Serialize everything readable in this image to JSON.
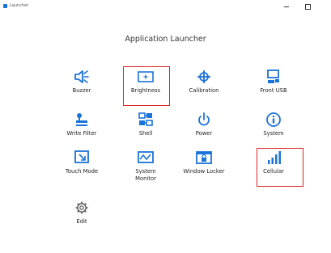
{
  "window": {
    "title": "Launcher",
    "minimize_glyph": "–",
    "maximize_glyph": "□"
  },
  "heading": "Application Launcher",
  "accent_color": "#1a73d8",
  "highlight_color": "#e02424",
  "tiles": [
    {
      "label": "Buzzer",
      "icon": "speaker-icon"
    },
    {
      "label": "Brightness",
      "icon": "brightness-icon",
      "highlighted": true
    },
    {
      "label": "Calibration",
      "icon": "crosshair-icon"
    },
    {
      "label": "Front USB",
      "icon": "usb-icon"
    },
    {
      "label": "Write Filter",
      "icon": "write-filter-icon"
    },
    {
      "label": "Shell",
      "icon": "shell-icon"
    },
    {
      "label": "Power",
      "icon": "power-icon"
    },
    {
      "label": "System",
      "icon": "info-icon"
    },
    {
      "label": "Touch Mode",
      "icon": "touch-mode-icon"
    },
    {
      "label": "System Monitor",
      "icon": "monitor-chart-icon"
    },
    {
      "label": "Window Locker",
      "icon": "window-lock-icon"
    },
    {
      "label": "Cellular",
      "icon": "signal-bars-icon",
      "highlighted": true
    },
    {
      "label": "Edit",
      "icon": "gear-icon"
    }
  ]
}
